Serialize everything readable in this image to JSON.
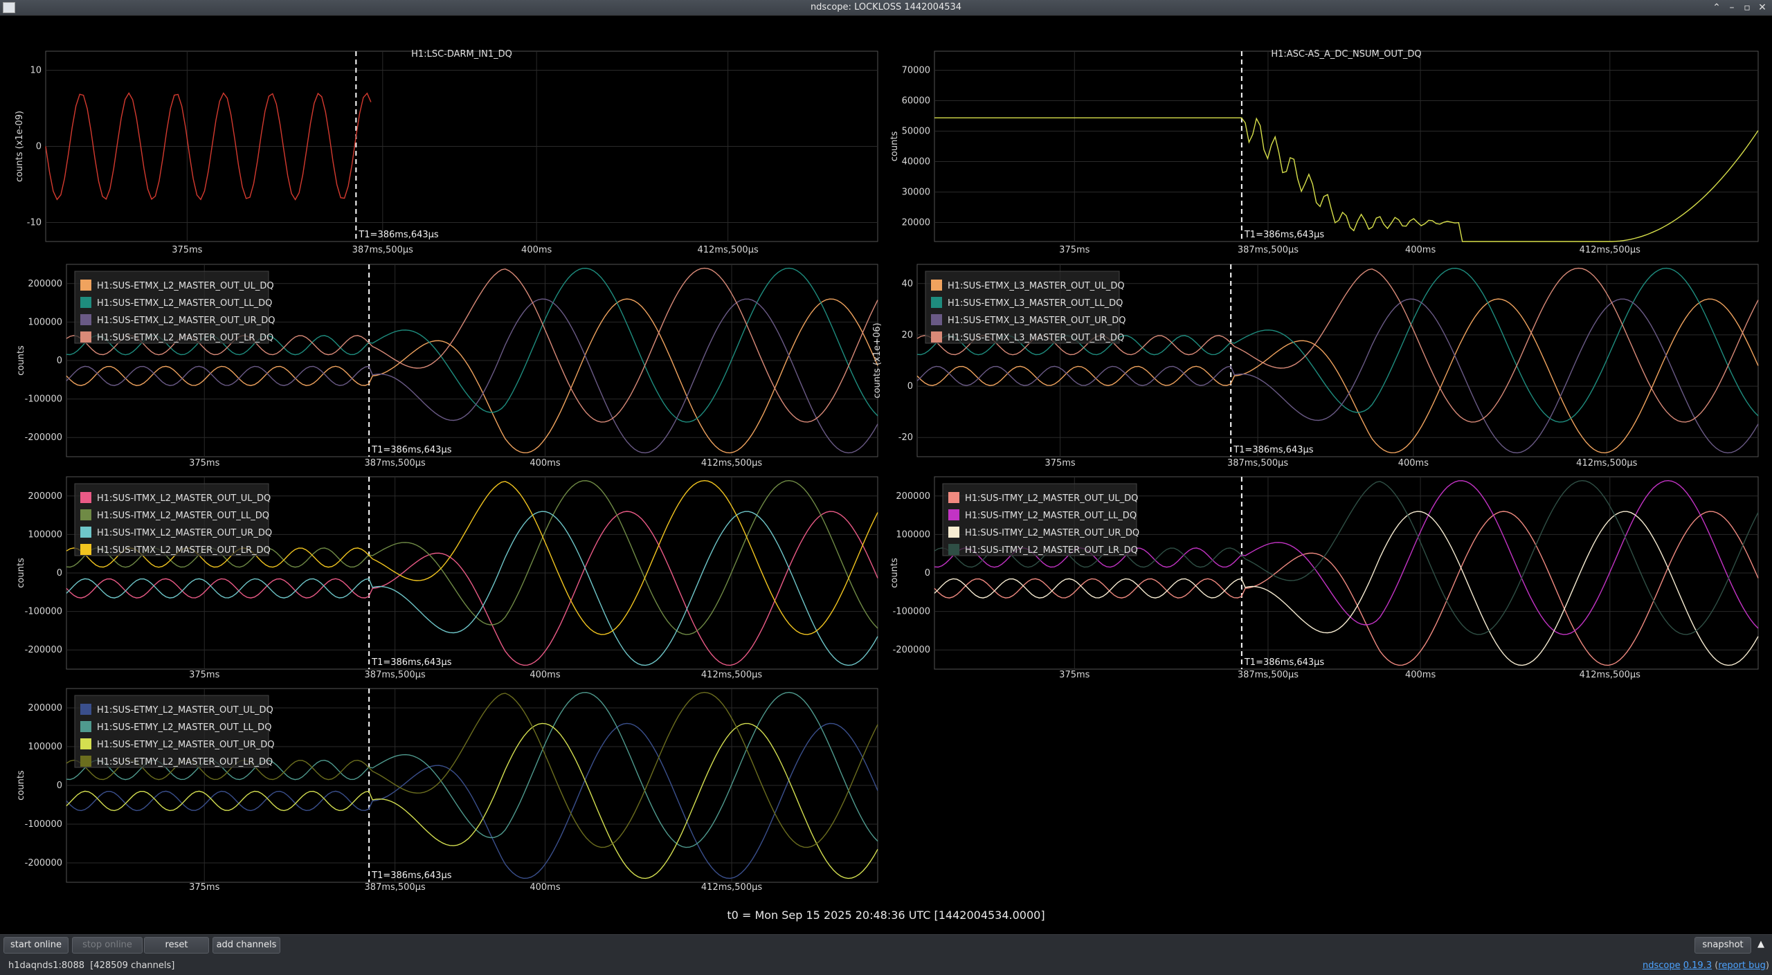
{
  "window": {
    "title": "ndscope: LOCKLOSS 1442004534"
  },
  "t0_label": "t0 = Mon Sep 15 2025 20:48:36 UTC [1442004534.0000]",
  "cursor_label": "T1=386ms,643µs",
  "x_ticks": [
    "375ms",
    "387ms,500µs",
    "400ms",
    "412ms,500µs"
  ],
  "plots": [
    {
      "id": "p1",
      "title": "H1:LSC-DARM_IN1_DQ",
      "ylabel": "counts (x1e-09)",
      "yticks": [
        "10",
        "0",
        "-10"
      ],
      "legend": [],
      "chart_data": {
        "type": "line",
        "series": [
          {
            "name": "H1:LSC-DARM_IN1_DQ",
            "color": "#d43a2f"
          }
        ],
        "note": "oscillation amplitude ~6.5e-09 until T1"
      }
    },
    {
      "id": "p2",
      "title": "H1:ASC-AS_A_DC_NSUM_OUT_DQ",
      "ylabel": "counts",
      "yticks": [
        "70000",
        "60000",
        "50000",
        "40000",
        "30000",
        "20000"
      ],
      "legend": [],
      "chart_data": {
        "type": "line",
        "series": [
          {
            "name": "H1:ASC-AS_A_DC_NSUM_OUT_DQ",
            "color": "#d7df4a"
          }
        ],
        "note": "flat ~54000 until T1, then drops"
      }
    },
    {
      "id": "p3",
      "title": "",
      "ylabel": "counts",
      "yticks": [
        "200000",
        "100000",
        "0",
        "-100000",
        "-200000"
      ],
      "legend": [
        {
          "label": "H1:SUS-ETMX_L2_MASTER_OUT_UL_DQ",
          "color": "#f0a35e"
        },
        {
          "label": "H1:SUS-ETMX_L2_MASTER_OUT_LL_DQ",
          "color": "#1e8c7e"
        },
        {
          "label": "H1:SUS-ETMX_L2_MASTER_OUT_UR_DQ",
          "color": "#6a5a86"
        },
        {
          "label": "H1:SUS-ETMX_L2_MASTER_OUT_LR_DQ",
          "color": "#d98a78"
        }
      ]
    },
    {
      "id": "p4",
      "title": "",
      "ylabel": "counts (x1e+06)",
      "yticks": [
        "40",
        "20",
        "0",
        "-20"
      ],
      "legend": [
        {
          "label": "H1:SUS-ETMX_L3_MASTER_OUT_UL_DQ",
          "color": "#f0a35e"
        },
        {
          "label": "H1:SUS-ETMX_L3_MASTER_OUT_LL_DQ",
          "color": "#1e8c7e"
        },
        {
          "label": "H1:SUS-ETMX_L3_MASTER_OUT_UR_DQ",
          "color": "#6a5a86"
        },
        {
          "label": "H1:SUS-ETMX_L3_MASTER_OUT_LR_DQ",
          "color": "#d98a78"
        }
      ]
    },
    {
      "id": "p5",
      "title": "",
      "ylabel": "counts",
      "yticks": [
        "200000",
        "100000",
        "0",
        "-100000",
        "-200000"
      ],
      "legend": [
        {
          "label": "H1:SUS-ITMX_L2_MASTER_OUT_UL_DQ",
          "color": "#ea5a86"
        },
        {
          "label": "H1:SUS-ITMX_L2_MASTER_OUT_LL_DQ",
          "color": "#6f8a45"
        },
        {
          "label": "H1:SUS-ITMX_L2_MASTER_OUT_UR_DQ",
          "color": "#6ec6c9"
        },
        {
          "label": "H1:SUS-ITMX_L2_MASTER_OUT_LR_DQ",
          "color": "#f2c51f"
        }
      ]
    },
    {
      "id": "p6",
      "title": "",
      "ylabel": "counts",
      "yticks": [
        "200000",
        "100000",
        "0",
        "-100000",
        "-200000"
      ],
      "legend": [
        {
          "label": "H1:SUS-ITMY_L2_MASTER_OUT_UL_DQ",
          "color": "#f08a80"
        },
        {
          "label": "H1:SUS-ITMY_L2_MASTER_OUT_LL_DQ",
          "color": "#c233c4"
        },
        {
          "label": "H1:SUS-ITMY_L2_MASTER_OUT_UR_DQ",
          "color": "#f7ecd2"
        },
        {
          "label": "H1:SUS-ITMY_L2_MASTER_OUT_LR_DQ",
          "color": "#2f4f45"
        }
      ]
    },
    {
      "id": "p7",
      "title": "",
      "ylabel": "counts",
      "yticks": [
        "200000",
        "100000",
        "0",
        "-100000",
        "-200000"
      ],
      "legend": [
        {
          "label": "H1:SUS-ETMY_L2_MASTER_OUT_UL_DQ",
          "color": "#3a4f8c"
        },
        {
          "label": "H1:SUS-ETMY_L2_MASTER_OUT_LL_DQ",
          "color": "#4f9a8e"
        },
        {
          "label": "H1:SUS-ETMY_L2_MASTER_OUT_UR_DQ",
          "color": "#d4df50"
        },
        {
          "label": "H1:SUS-ETMY_L2_MASTER_OUT_LR_DQ",
          "color": "#6b6d1e"
        }
      ]
    }
  ],
  "toolbar": {
    "start_online": "start online",
    "stop_online": "stop online",
    "reset": "reset",
    "add_channels": "add channels",
    "snapshot": "snapshot"
  },
  "status": {
    "server": "h1daqnds1:8088",
    "channels": "[428509 channels]",
    "app_name": "ndscope",
    "version": "0.19.3",
    "report_bug": "report bug"
  }
}
